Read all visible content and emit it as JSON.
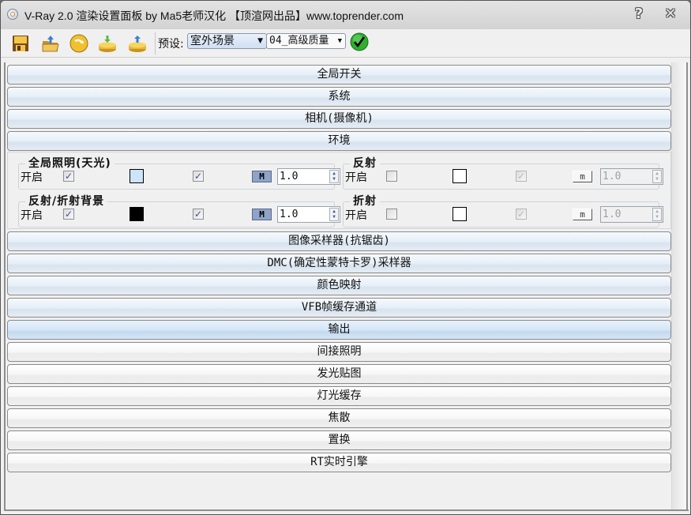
{
  "window": {
    "title": "V-Ray 2.0 渲染设置面板 by Ma5老师汉化 【顶渲网出品】www.toprender.com",
    "help_label": "?",
    "close_label": "✕"
  },
  "toolbar": {
    "icons": [
      "save-icon",
      "open-folder-icon",
      "refresh-icon",
      "import-icon",
      "export-icon"
    ],
    "preset_label": "预设:",
    "scene_preset": "室外场景",
    "quality_preset": "04_高级质量",
    "apply_icon": "checkmark-icon"
  },
  "rollouts_top": [
    {
      "label": "全局开关",
      "state": "open"
    },
    {
      "label": "系统",
      "state": "open"
    },
    {
      "label": "相机(摄像机)",
      "state": "open"
    },
    {
      "label": "环境",
      "state": "open"
    }
  ],
  "environment": {
    "gi": {
      "title": "全局照明(天光)",
      "on_label": "开启",
      "on_checked": true,
      "color": "#cce4fc",
      "map_checked": true,
      "map_button": "M",
      "multiplier": "1.0"
    },
    "reflection": {
      "title": "反射",
      "on_label": "开启",
      "on_checked": false,
      "color": "#ffffff",
      "map_checked": true,
      "map_button": "m",
      "multiplier": "1.0"
    },
    "refl_refr_bg": {
      "title": "反射/折射背景",
      "on_label": "开启",
      "on_checked": true,
      "color": "#000000",
      "map_checked": true,
      "map_button": "M",
      "multiplier": "1.0"
    },
    "refraction": {
      "title": "折射",
      "on_label": "开启",
      "on_checked": false,
      "color": "#ffffff",
      "map_checked": true,
      "map_button": "m",
      "multiplier": "1.0"
    }
  },
  "rollouts_bottom": [
    {
      "label": "图像采样器(抗锯齿)",
      "state": "open"
    },
    {
      "label": "DMC(确定性蒙特卡罗)采样器",
      "state": "open"
    },
    {
      "label": "颜色映射",
      "state": "open"
    },
    {
      "label": "VFB帧缓存通道",
      "state": "open"
    },
    {
      "label": "输出",
      "state": "selected"
    },
    {
      "label": "间接照明",
      "state": "closed"
    },
    {
      "label": "发光贴图",
      "state": "closed"
    },
    {
      "label": "灯光缓存",
      "state": "closed"
    },
    {
      "label": "焦散",
      "state": "closed"
    },
    {
      "label": "置换",
      "state": "closed"
    },
    {
      "label": "RT实时引擎",
      "state": "closed"
    }
  ]
}
